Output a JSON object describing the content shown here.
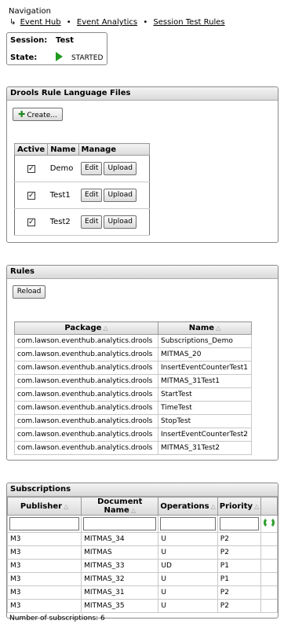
{
  "navigation": {
    "title": "Navigation",
    "breadcrumb": [
      {
        "label": "Event Hub"
      },
      {
        "label": "Event Analytics"
      },
      {
        "label": "Session Test Rules"
      }
    ],
    "separator": "•"
  },
  "session": {
    "session_label": "Session:",
    "session_name": "Test",
    "state_label": "State:",
    "state_value": "STARTED"
  },
  "drools": {
    "title": "Drools Rule Language Files",
    "create_label": "Create...",
    "headers": {
      "active": "Active",
      "name": "Name",
      "manage": "Manage"
    },
    "edit_label": "Edit",
    "upload_label": "Upload",
    "files": [
      {
        "name": "Demo",
        "active": true
      },
      {
        "name": "Test1",
        "active": true
      },
      {
        "name": "Test2",
        "active": true
      }
    ]
  },
  "rules": {
    "title": "Rules",
    "reload_label": "Reload",
    "headers": {
      "package": "Package",
      "name": "Name"
    },
    "rows": [
      {
        "package": "com.lawson.eventhub.analytics.drools",
        "name": "Subscriptions_Demo"
      },
      {
        "package": "com.lawson.eventhub.analytics.drools",
        "name": "MITMAS_20"
      },
      {
        "package": "com.lawson.eventhub.analytics.drools",
        "name": "InsertEventCounterTest1"
      },
      {
        "package": "com.lawson.eventhub.analytics.drools",
        "name": "MITMAS_31Test1"
      },
      {
        "package": "com.lawson.eventhub.analytics.drools",
        "name": "StartTest"
      },
      {
        "package": "com.lawson.eventhub.analytics.drools",
        "name": "TimeTest"
      },
      {
        "package": "com.lawson.eventhub.analytics.drools",
        "name": "StopTest"
      },
      {
        "package": "com.lawson.eventhub.analytics.drools",
        "name": "InsertEventCounterTest2"
      },
      {
        "package": "com.lawson.eventhub.analytics.drools",
        "name": "MITMAS_31Test2"
      }
    ]
  },
  "subscriptions": {
    "title": "Subscriptions",
    "headers": {
      "publisher": "Publisher",
      "document": "Document Name",
      "operations": "Operations",
      "priority": "Priority"
    },
    "rows": [
      {
        "publisher": "M3",
        "document": "MITMAS_34",
        "operations": "U",
        "priority": "P2"
      },
      {
        "publisher": "M3",
        "document": "MITMAS",
        "operations": "U",
        "priority": "P2"
      },
      {
        "publisher": "M3",
        "document": "MITMAS_33",
        "operations": "UD",
        "priority": "P1"
      },
      {
        "publisher": "M3",
        "document": "MITMAS_32",
        "operations": "U",
        "priority": "P1"
      },
      {
        "publisher": "M3",
        "document": "MITMAS_31",
        "operations": "U",
        "priority": "P2"
      },
      {
        "publisher": "M3",
        "document": "MITMAS_35",
        "operations": "U",
        "priority": "P2"
      }
    ],
    "count_label": "Number of subscriptions: 6"
  },
  "icons": {
    "breadcrumb": "corner-arrow-icon",
    "state": "play-icon",
    "create": "plus-icon",
    "sort": "sort-triangle-icon",
    "refresh": "refresh-icon",
    "checkbox": "checkbox-icon"
  },
  "colors": {
    "play": "#1f9a1f",
    "header_top": "#f4f4f4",
    "header_bottom": "#d9d9d9",
    "border": "#8a8a8a"
  }
}
